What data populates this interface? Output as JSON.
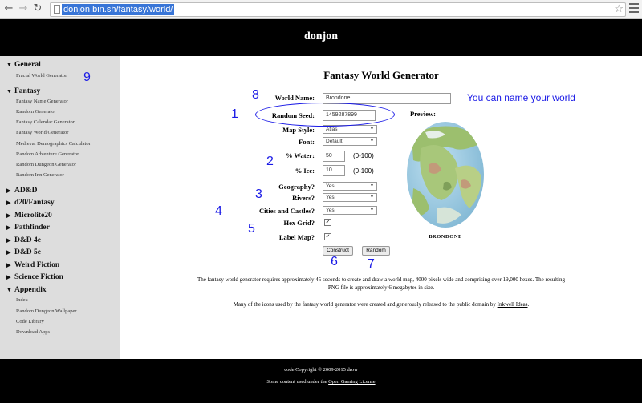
{
  "browser": {
    "url": "donjon.bin.sh/fantasy/world/"
  },
  "site": {
    "title": "donjon"
  },
  "sidebar": {
    "sections": [
      {
        "label": "General",
        "expanded": true,
        "items": [
          "Fractal World Generator"
        ]
      },
      {
        "label": "Fantasy",
        "expanded": true,
        "items": [
          "Fantasy Name Generator",
          "Random Generator",
          "Fantasy Calendar Generator",
          "Fantasy World Generator",
          "Medieval Demographics Calculator",
          "Random Adventure Generator",
          "Random Dungeon Generator",
          "Random Inn Generator"
        ]
      },
      {
        "label": "AD&D",
        "expanded": false,
        "items": []
      },
      {
        "label": "d20/Fantasy",
        "expanded": false,
        "items": []
      },
      {
        "label": "Microlite20",
        "expanded": false,
        "items": []
      },
      {
        "label": "Pathfinder",
        "expanded": false,
        "items": []
      },
      {
        "label": "D&D 4e",
        "expanded": false,
        "items": []
      },
      {
        "label": "D&D 5e",
        "expanded": false,
        "items": []
      },
      {
        "label": "Weird Fiction",
        "expanded": false,
        "items": []
      },
      {
        "label": "Science Fiction",
        "expanded": false,
        "items": []
      },
      {
        "label": "Appendix",
        "expanded": true,
        "items": [
          "Index",
          "Random Dungeon Wallpaper",
          "Code Library",
          "Download Apps"
        ]
      }
    ],
    "tri_open": "▼",
    "tri_closed": "▶"
  },
  "main": {
    "title": "Fantasy World Generator",
    "form": {
      "world_name_label": "World Name:",
      "world_name_value": "Brondone",
      "seed_label": "Random Seed:",
      "seed_value": "1459287899",
      "map_style_label": "Map Style:",
      "map_style_value": "Atlas",
      "font_label": "Font:",
      "font_value": "Default",
      "water_label": "% Water:",
      "water_value": "50",
      "water_range": "(0-100)",
      "ice_label": "% Ice:",
      "ice_value": "10",
      "ice_range": "(0-100)",
      "geography_label": "Geography?",
      "geography_value": "Yes",
      "rivers_label": "Rivers?",
      "rivers_value": "Yes",
      "cities_label": "Cities and Castles?",
      "cities_value": "Yes",
      "hexgrid_label": "Hex Grid?",
      "hexgrid_checked": "✓",
      "labelmap_label": "Label Map?",
      "labelmap_checked": "✓",
      "construct_label": "Construct",
      "random_label": "Random"
    },
    "preview_label": "Preview:",
    "preview_name": "BRONDONE",
    "para1": "The fantasy world generator requires approximately 45 seconds to create and draw a world map, 4000 pixels wide and comprising over 19,000 hexes. The resulting PNG file is approximately 6 megabytes in size.",
    "para2_pre": "Many of the icons used by the fantasy world generator were created and generously released to the public domain by ",
    "para2_link": "Inkwell Ideas",
    "para2_post": "."
  },
  "annotations": {
    "n1": "1",
    "n2": "2",
    "n3": "3",
    "n4": "4",
    "n5": "5",
    "n6": "6",
    "n7": "7",
    "n8": "8",
    "n9": "9",
    "name_note": "You can name your world",
    "color": "#1a1ae6"
  },
  "footer": {
    "copyright": "code Copyright © 2009-2015 drow",
    "license_pre": "Some content used under the ",
    "license_link": "Open Gaming License"
  }
}
